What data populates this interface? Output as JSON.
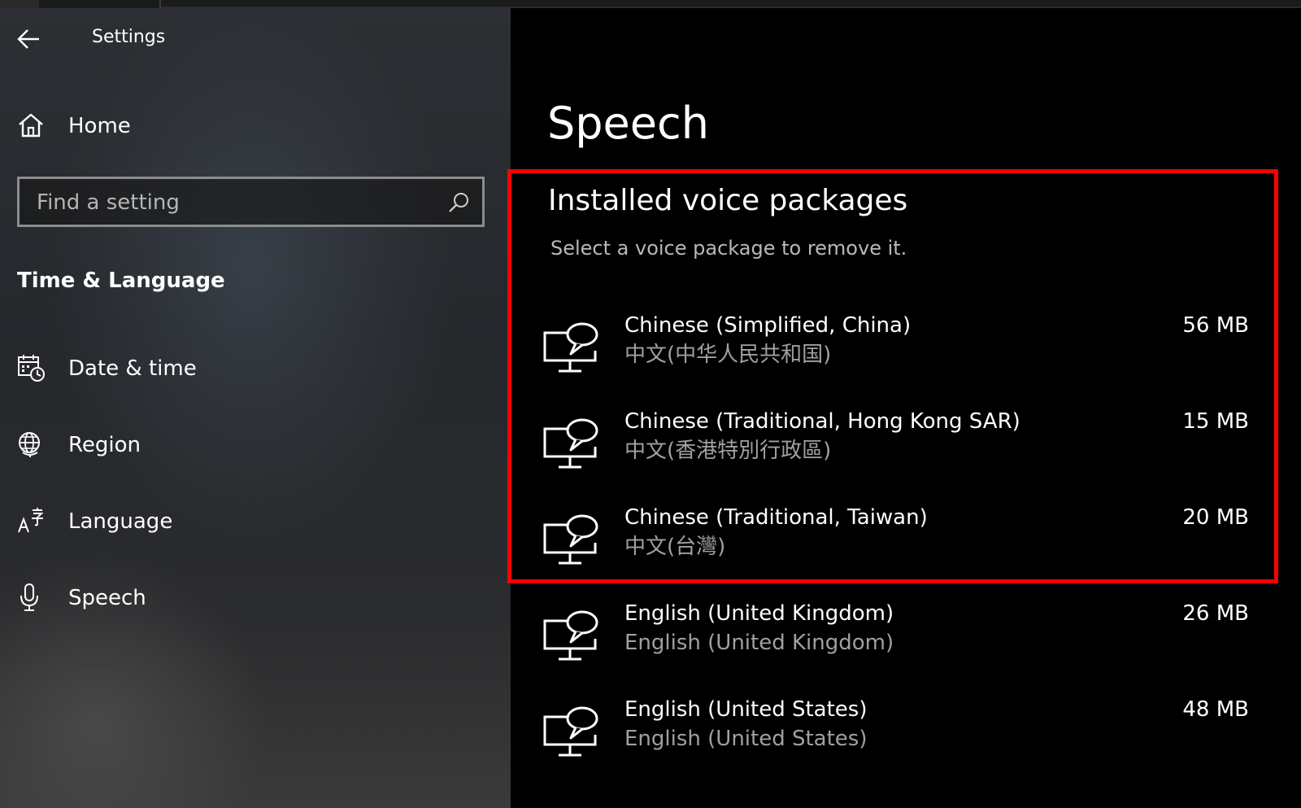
{
  "window": {
    "title": "Settings"
  },
  "sidebar": {
    "home_label": "Home",
    "search_placeholder": "Find a setting",
    "section_header": "Time & Language",
    "items": [
      {
        "label": "Date & time",
        "icon": "calendar-clock-icon"
      },
      {
        "label": "Region",
        "icon": "globe-icon"
      },
      {
        "label": "Language",
        "icon": "language-icon"
      },
      {
        "label": "Speech",
        "icon": "microphone-icon"
      }
    ]
  },
  "main": {
    "page_title": "Speech",
    "section_title": "Installed voice packages",
    "section_desc": "Select a voice package to remove it.",
    "voice_packages": [
      {
        "name": "Chinese (Simplified, China)",
        "native": "中文(中华人民共和国)",
        "size": "56 MB"
      },
      {
        "name": "Chinese (Traditional, Hong Kong SAR)",
        "native": "中文(香港特別行政區)",
        "size": "15 MB"
      },
      {
        "name": "Chinese (Traditional, Taiwan)",
        "native": "中文(台灣)",
        "size": "20 MB"
      },
      {
        "name": "English (United Kingdom)",
        "native": "English (United Kingdom)",
        "size": "26 MB"
      },
      {
        "name": "English (United States)",
        "native": "English (United States)",
        "size": "48 MB"
      }
    ]
  },
  "colors": {
    "highlight": "#ff0000",
    "text_primary": "#ffffff",
    "text_secondary": "#a0a0a0",
    "background": "#000000"
  }
}
